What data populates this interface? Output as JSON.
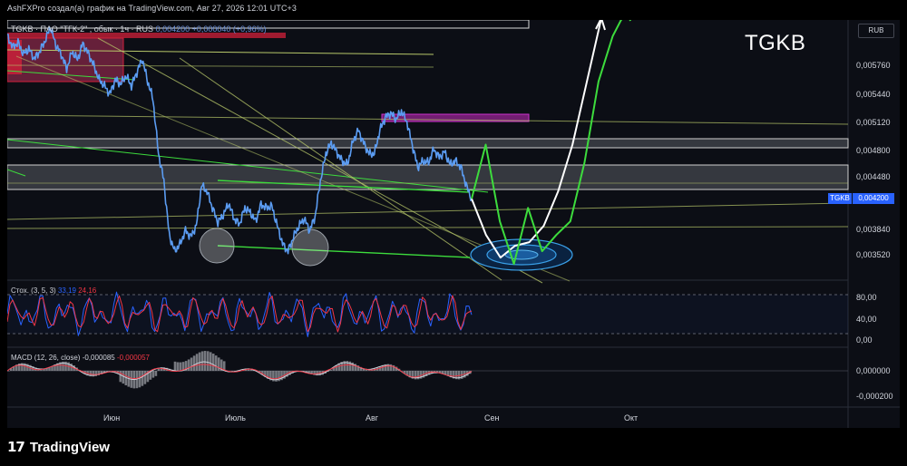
{
  "caption": "AshFXPro создал(а) график на TradingView.com, Авг 27, 2026 12:01 UTC+3",
  "brand": "TradingView",
  "symbol": {
    "text": "TGKB · ПАО \"ТГК-2\" , обык · 1ч · RUS",
    "values": "0,004200 +0,000040 (+0,96%)",
    "big_ticker": "TGKB",
    "currency": "RUB"
  },
  "price_badge": {
    "name": "TGKB",
    "value": "0,004200",
    "color": "#2962ff"
  },
  "colors": {
    "price_line": "#5b9cf2",
    "bg": "#0c0e15",
    "stoch_k": "#2962ff",
    "stoch_d": "#f23645",
    "forecast_up": "#ffffff",
    "forecast_alt": "#3ddc3d",
    "zone": "#cc33cc"
  },
  "chart_data": [
    {
      "type": "line",
      "title": "",
      "x_categories": [
        "Июн",
        "Июль",
        "Авг",
        "Сен",
        "Окт"
      ],
      "y_ticks": [
        "0,005760",
        "0,005440",
        "0,005120",
        "0,004800",
        "0,004480",
        "0,004200",
        "0,003840",
        "0,003520"
      ],
      "ylim": [
        0.0033,
        0.00618
      ],
      "series": [
        {
          "values": [
            0.006,
            0.00588,
            0.00593,
            0.0058,
            0.00586,
            0.00575,
            0.00583,
            0.00595,
            0.0061,
            0.0059,
            0.0058,
            0.00564,
            0.00583,
            0.00574,
            0.00592,
            0.00581,
            0.00568,
            0.00552,
            0.00545,
            0.00536,
            0.00552,
            0.00547,
            0.00556,
            0.00545,
            0.0056,
            0.00575,
            0.0055,
            0.0053,
            0.0047,
            0.0044,
            0.0038,
            0.00362,
            0.0037,
            0.00385,
            0.00378,
            0.0039,
            0.00435,
            0.00428,
            0.0041,
            0.00394,
            0.00402,
            0.00415,
            0.00398,
            0.00392,
            0.0041,
            0.00405,
            0.00395,
            0.00414,
            0.0041,
            0.00412,
            0.0039,
            0.0037,
            0.00362,
            0.00378,
            0.0039,
            0.00398,
            0.00385,
            0.004,
            0.0044,
            0.0047,
            0.00482,
            0.00472,
            0.00462,
            0.00458,
            0.00483,
            0.00496,
            0.00482,
            0.0047,
            0.0047,
            0.00496,
            0.0051,
            0.00515,
            0.00508,
            0.00517,
            0.00505,
            0.0048,
            0.00455,
            0.00462,
            0.0046,
            0.00475,
            0.00466,
            0.00472,
            0.00458,
            0.00462,
            0.00455,
            0.00435,
            0.0042
          ]
        },
        {
          "name": "",
          "values": [
            0.0042,
            0.0038,
            0.00355,
            0.00368,
            0.00372,
            0.0039,
            0.00428,
            0.0048,
            0.0055,
            0.0062
          ]
        },
        {
          "name": "",
          "values": [
            0.0042,
            0.0048,
            0.00395,
            0.00348,
            0.0041,
            0.00362,
            0.0038,
            0.00395,
            0.0046,
            0.0055,
            0.006,
            0.0063
          ]
        }
      ]
    },
    {
      "type": "line",
      "title": "Стох. (3, 5, 3)",
      "values_label": [
        "33,19",
        "24,16"
      ],
      "y_ticks": [
        "80,00",
        "40,00",
        "0,00"
      ],
      "ylim": [
        0,
        100
      ]
    },
    {
      "type": "bar",
      "title": "MACD (12, 26, close)",
      "values_label": [
        "-0,000085",
        "-0,000057"
      ],
      "y_ticks": [
        "0,000000",
        "-0,000200"
      ]
    }
  ]
}
